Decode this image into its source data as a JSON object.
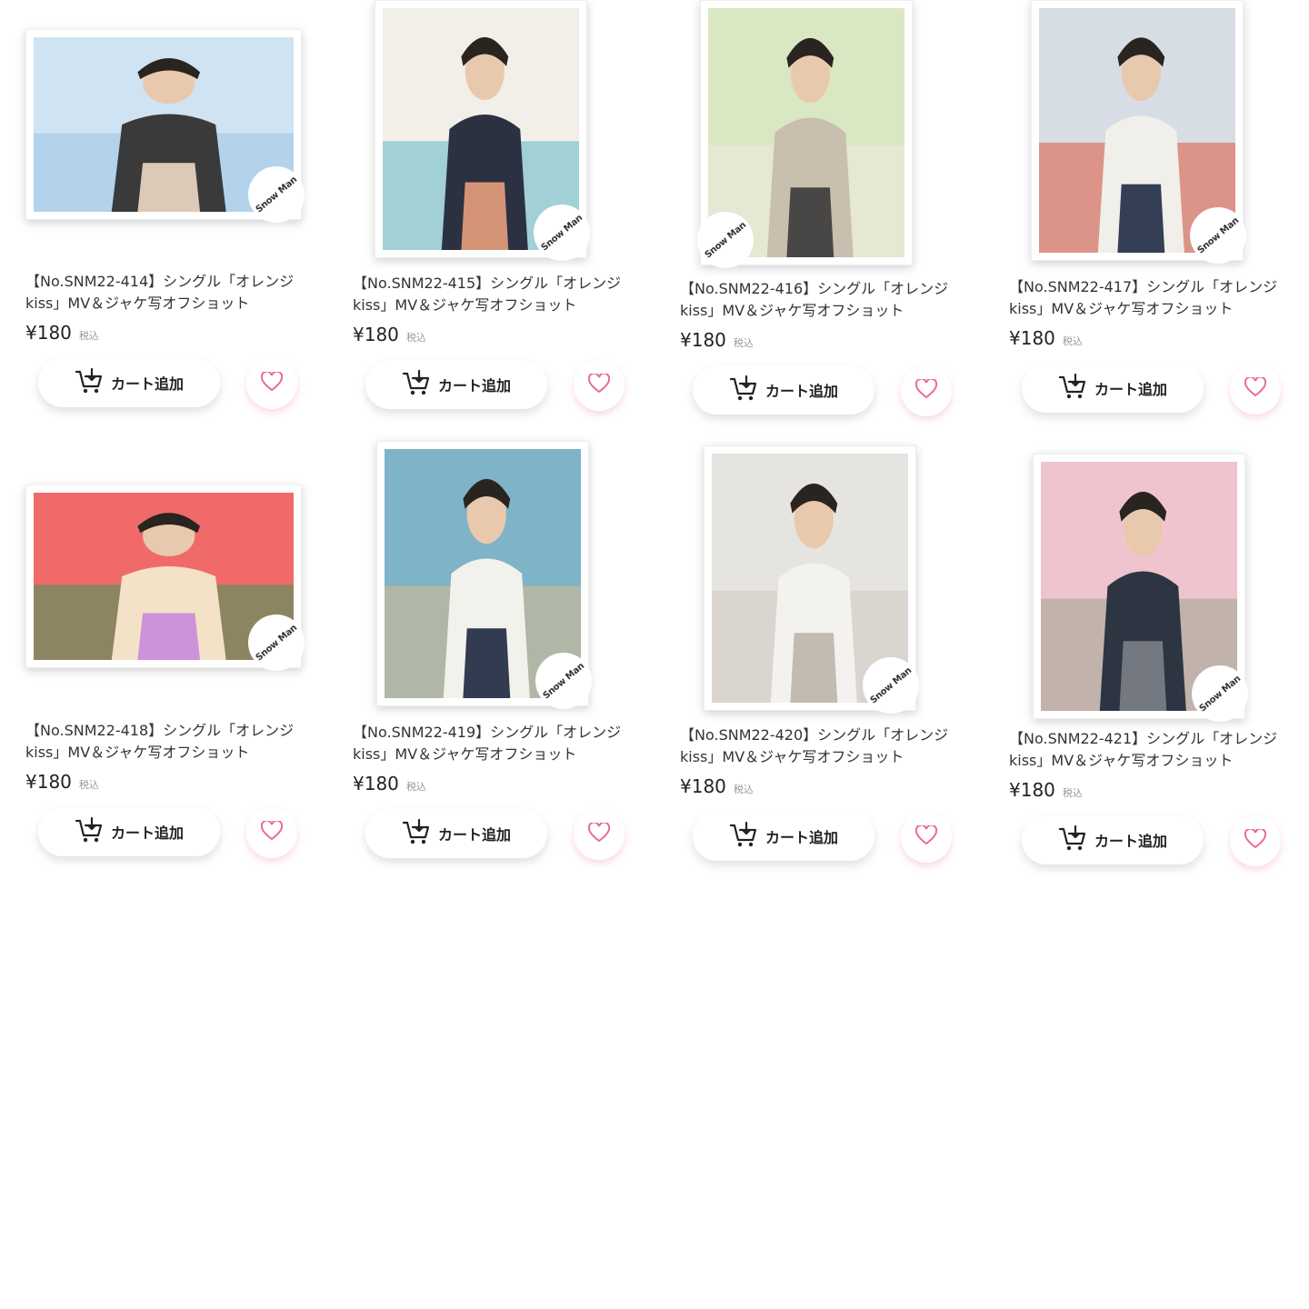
{
  "colors": {
    "heart": "#e86a9a",
    "text": "#333333",
    "price": "#222222",
    "tax": "#999999"
  },
  "products": [
    {
      "title": "【No.SNM22-414】シングル「オレンジkiss」MV＆ジャケ写オフショット",
      "price": "¥180",
      "tax": "税込",
      "cart_label": "カート追加",
      "logo": "Snow Man",
      "orientation": "landscape",
      "palette": [
        "#cfe3f2",
        "#9dc4e6",
        "#3a3a3a",
        "#f0d9c7"
      ]
    },
    {
      "title": "【No.SNM22-415】シングル「オレンジkiss」MV＆ジャケ写オフショット",
      "price": "¥180",
      "tax": "税込",
      "cart_label": "カート追加",
      "logo": "Snow Man",
      "orientation": "portrait",
      "palette": [
        "#f2efe8",
        "#5fb7c9",
        "#2c3142",
        "#e9a07c"
      ]
    },
    {
      "title": "【No.SNM22-416】シングル「オレンジkiss」MV＆ジャケ写オフショット",
      "price": "¥180",
      "tax": "税込",
      "cart_label": "カート追加",
      "logo": "Snow Man",
      "orientation": "portrait",
      "palette": [
        "#d9e7c2",
        "#eeeae2",
        "#c9bfae",
        "#3a3a3a"
      ]
    },
    {
      "title": "【No.SNM22-417】シングル「オレンジkiss」MV＆ジャケ写オフショット",
      "price": "¥180",
      "tax": "税込",
      "cart_label": "カート追加",
      "logo": "Snow Man",
      "orientation": "portrait",
      "palette": [
        "#d7dde4",
        "#e0573e",
        "#f1efe9",
        "#1f2a44"
      ]
    },
    {
      "title": "【No.SNM22-418】シングル「オレンジkiss」MV＆ジャケ写オフショット",
      "price": "¥180",
      "tax": "税込",
      "cart_label": "カート追加",
      "logo": "Snow Man",
      "orientation": "landscape",
      "palette": [
        "#f06a6a",
        "#3c9b5a",
        "#f3e1c8",
        "#c98ad8"
      ]
    },
    {
      "title": "【No.SNM22-419】シングル「オレンジkiss」MV＆ジャケ写オフショット",
      "price": "¥180",
      "tax": "税込",
      "cart_label": "カート追加",
      "logo": "Snow Man",
      "orientation": "portrait",
      "palette": [
        "#7fb3c8",
        "#d9b98c",
        "#f3f1ec",
        "#1e2740"
      ]
    },
    {
      "title": "【No.SNM22-420】シングル「オレンジkiss」MV＆ジャケ写オフショット",
      "price": "¥180",
      "tax": "税込",
      "cart_label": "カート追加",
      "logo": "Snow Man",
      "orientation": "portrait",
      "palette": [
        "#e6e4e0",
        "#cfc9c1",
        "#f4f2ee",
        "#bdb5ab"
      ]
    },
    {
      "title": "【No.SNM22-421】シングル「オレンジkiss」MV＆ジャケ写オフショット",
      "price": "¥180",
      "tax": "税込",
      "cart_label": "カート追加",
      "logo": "Snow Man",
      "orientation": "portrait",
      "palette": [
        "#f0c4cf",
        "#9aa58f",
        "#2d3542",
        "#7c8088"
      ]
    }
  ]
}
